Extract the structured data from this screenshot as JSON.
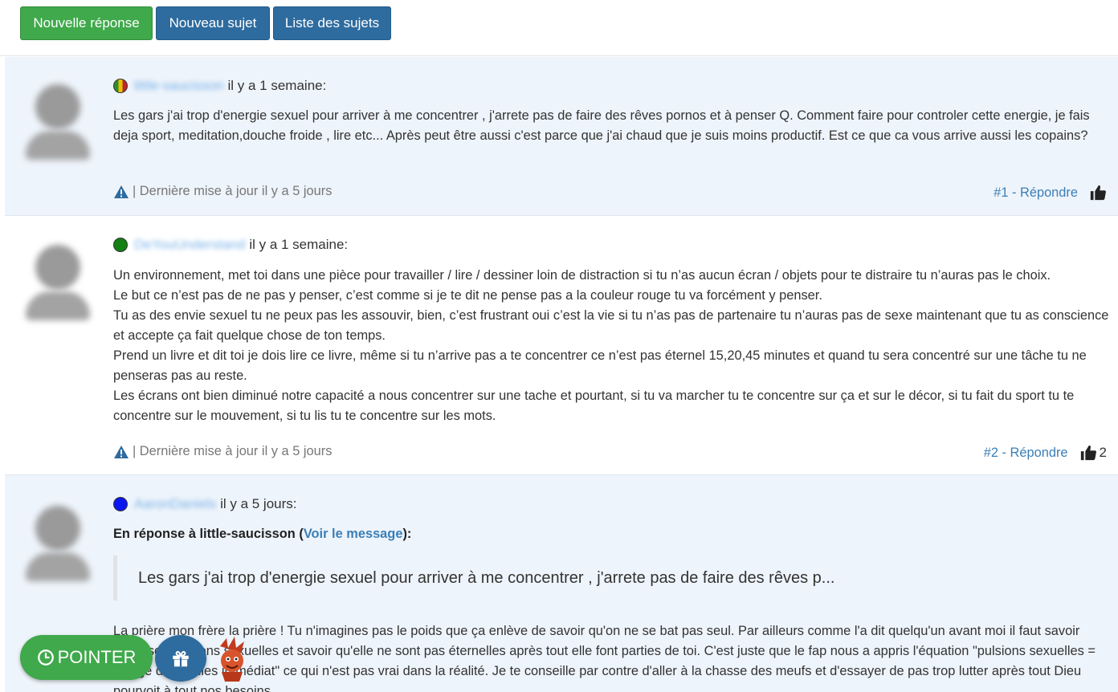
{
  "toolbar": {
    "new_reply": "Nouvelle réponse",
    "new_topic": "Nouveau sujet",
    "topic_list": "Liste des sujets"
  },
  "posts": [
    {
      "username": "little-saucisson",
      "time": "il y a 1 semaine:",
      "paragraphs": [
        "Les gars j'ai trop d'energie sexuel pour arriver à me concentrer , j'arrete pas de faire des rêves pornos et à penser Q. Comment faire pour controler cette energie, je fais deja sport, meditation,douche froide , lire etc... Après peut être aussi c'est parce que j'ai chaud que je suis moins productif. Est ce que ca vous arrive aussi les copains?"
      ],
      "updated": "| Dernière mise à jour il y a 5 jours",
      "reply_link": "#1 - Répondre",
      "likes": ""
    },
    {
      "username": "DeYouUnderstand",
      "time": "il y a 1 semaine:",
      "paragraphs": [
        "Un environnement, met toi dans une pièce pour travailler / lire / dessiner loin de distraction si tu n’as aucun écran / objets pour te distraire tu n’auras pas le choix.",
        "Le but ce n’est pas de ne pas y penser, c’est comme si je te dit ne pense pas a la couleur rouge tu va forcément y penser.",
        "Tu as des envie sexuel tu ne peux pas les assouvir, bien, c’est frustrant oui c’est la vie si tu n’as pas de partenaire tu n’auras pas de sexe maintenant que tu as conscience et accepte ça fait quelque chose de ton temps.",
        "Prend un livre et dit toi je dois lire ce livre, même si tu n’arrive pas a te concentrer ce n’est pas éternel 15,20,45 minutes et quand tu sera concentré sur une tâche tu ne penseras pas au reste.",
        "Les écrans ont bien diminué notre capacité a nous concentrer sur une tache et pourtant, si tu va marcher tu te concentre sur ça et sur le décor, si tu fait du sport tu te concentre sur le mouvement, si tu lis tu te concentre sur les mots."
      ],
      "updated": "| Dernière mise à jour il y a 5 jours",
      "reply_link": "#2 - Répondre",
      "likes": "2"
    },
    {
      "username": "AaronDaniels",
      "time": "il y a 5 jours:",
      "reply_to_prefix": "En réponse à little-saucisson (",
      "reply_to_link": "Voir le message",
      "reply_to_suffix": "):",
      "quote": "Les gars j'ai trop d'energie sexuel pour arriver à me concentrer , j'arrete pas de faire des rêves p...",
      "paragraphs": [
        "La prière mon frère la prière ! Tu n'imagines pas le poids que ça enlève de savoir qu'on ne se bat pas seul. Par ailleurs comme l'a dit quelqu'un avant moi il faut savoir gérer ses pulsions sexuelles et savoir qu'elle ne sont pas éternelles après tout elle font parties de toi. C'est juste que le fap nous a appris l'équation \"pulsions sexuelles = vidage de couilles immédiat\" ce qui n'est pas vrai dans la réalité. Je te conseille par contre d'aller à la chasse des meufs et d'essayer de pas trop lutter après tout Dieu pourvoit à tout nos besoins."
      ]
    }
  ],
  "floating": {
    "pointer_label": "POINTER"
  },
  "icons": {
    "warning": "warning-triangle-icon",
    "like": "thumbs-up-icon",
    "clock": "clock-icon",
    "gift": "gift-icon",
    "mascot": "mascot-icon"
  },
  "colors": {
    "green": "#3fa94b",
    "blue": "#2e6b9e",
    "link": "#3a7fb8",
    "alt_row": "#eef4fb"
  }
}
